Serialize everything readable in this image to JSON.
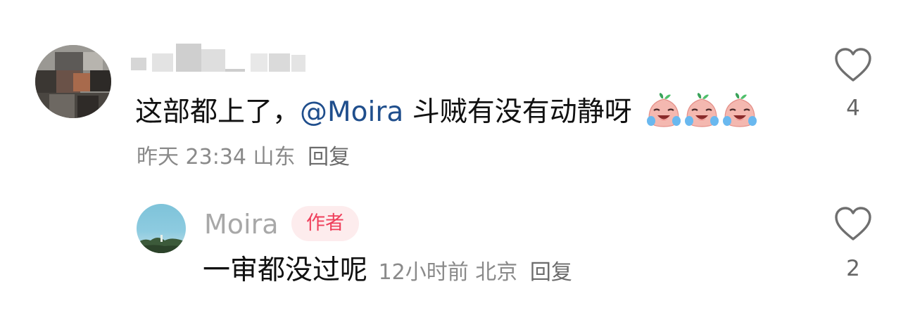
{
  "comments": [
    {
      "username": "",
      "text_before": "这部都上了，",
      "mention": "@Moira",
      "text_after": " 斗贼有没有动静呀",
      "emojis": [
        "crying-laughing-emoji",
        "crying-laughing-emoji",
        "crying-laughing-emoji"
      ],
      "time": "昨天 23:34",
      "location": "山东",
      "reply_label": "回复",
      "like_count": "4",
      "like_icon": "heart-outline-icon"
    }
  ],
  "reply": {
    "username": "Moira",
    "author_badge": "作者",
    "text": "一审都没过呢",
    "time": "12小时前",
    "location": "北京",
    "reply_label": "回复",
    "like_count": "2",
    "like_icon": "heart-outline-icon"
  },
  "colors": {
    "mention": "#1f4e8c",
    "badge_text": "#ef3f5b",
    "badge_bg": "#fdeced",
    "meta_text": "#8a8a8a"
  }
}
